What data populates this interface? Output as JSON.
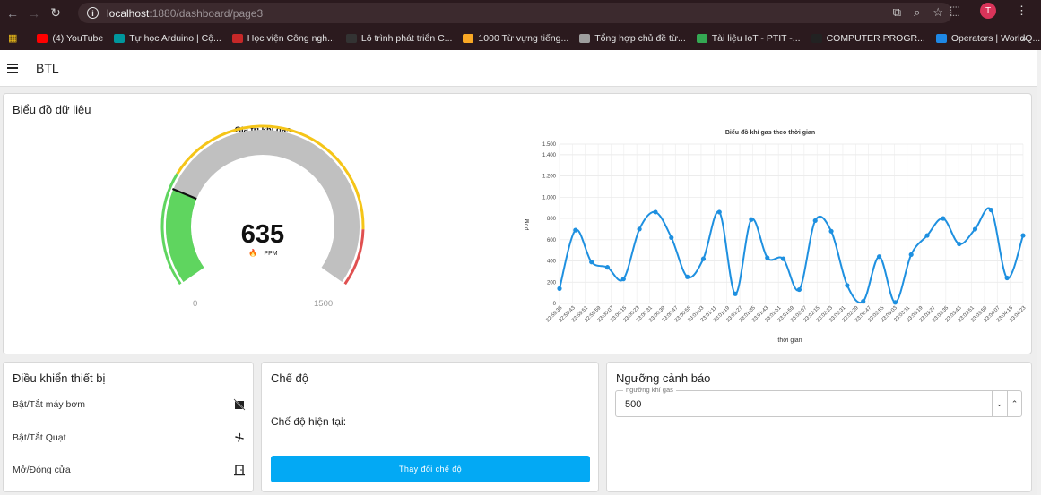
{
  "browser": {
    "url_host": "localhost",
    "url_path": ":1880/dashboard/page3",
    "avatar_letter": "T",
    "bookmarks": [
      {
        "label": "(4) YouTube",
        "color": "#ff0000"
      },
      {
        "label": "Tự học Arduino | Cộ...",
        "color": "#00979d"
      },
      {
        "label": "Học viện Công ngh...",
        "color": "#c62828"
      },
      {
        "label": "Lộ trình phát triển C...",
        "color": "#333333"
      },
      {
        "label": "1000 Từ vựng tiếng...",
        "color": "#f9a825"
      },
      {
        "label": "Tổng hợp chủ đề từ...",
        "color": "#9e9e9e"
      },
      {
        "label": "Tài liệu IoT - PTIT -...",
        "color": "#34a853"
      },
      {
        "label": "COMPUTER PROGR...",
        "color": "#222222"
      },
      {
        "label": "Operators | WorldQ...",
        "color": "#1e88e5"
      }
    ]
  },
  "app": {
    "title": "BTL"
  },
  "data_card": {
    "title": "Biểu đồ dữ liệu",
    "gauge": {
      "title": "Giá trị khí gas",
      "value": "635",
      "unit": "PPM",
      "min_label": "0",
      "max_label": "1500",
      "value_num": 635,
      "max": 1500,
      "green_end": 400,
      "yellow_end": 1300,
      "color_green": "#5fd55f",
      "color_yellow": "#f5c518",
      "color_red": "#e05050",
      "color_track": "#c0c0c0"
    }
  },
  "chart_data": {
    "type": "line",
    "title": "Biểu đồ khí gas theo thời gian",
    "xlabel": "thời gian",
    "ylabel": "PPM",
    "ylim": [
      0,
      1500
    ],
    "y_ticks": [
      "0",
      "200",
      "400",
      "600",
      "800",
      "1.000",
      "1.200",
      "1.400",
      "1.500"
    ],
    "y_tick_values": [
      0,
      200,
      400,
      600,
      800,
      1000,
      1200,
      1400,
      1500
    ],
    "grid": true,
    "line_color": "#1e90e0",
    "categories": [
      "22:59:35",
      "22:59:43",
      "22:59:51",
      "22:59:59",
      "23:00:07",
      "23:00:15",
      "23:00:23",
      "23:00:31",
      "23:00:39",
      "23:00:47",
      "23:00:55",
      "23:01:03",
      "23:01:11",
      "23:01:19",
      "23:01:27",
      "23:01:35",
      "23:01:43",
      "23:01:51",
      "23:01:59",
      "23:02:07",
      "23:02:15",
      "23:02:23",
      "23:02:31",
      "23:02:39",
      "23:02:47",
      "23:02:55",
      "23:03:03",
      "23:03:11",
      "23:03:19",
      "23:03:27",
      "23:03:35",
      "23:03:43",
      "23:03:51",
      "23:03:59",
      "23:04:07",
      "23:04:15",
      "23:04:23"
    ],
    "values": [
      140,
      690,
      390,
      340,
      230,
      700,
      860,
      620,
      250,
      420,
      860,
      90,
      790,
      430,
      420,
      130,
      780,
      680,
      170,
      20,
      440,
      10,
      460,
      640,
      800,
      560,
      700,
      880,
      240,
      640
    ]
  },
  "device_card": {
    "title": "Điều khiển thiết bị",
    "items": [
      {
        "label": "Bật/Tắt máy bơm",
        "icon": "pump-off-icon"
      },
      {
        "label": "Bật/Tắt Quạt",
        "icon": "fan-icon"
      },
      {
        "label": "Mở/Đóng cửa",
        "icon": "door-icon"
      }
    ]
  },
  "mode_card": {
    "title": "Chế độ",
    "current_label": "Chế độ hiện tại:",
    "button_label": "Thay đổi chế độ"
  },
  "threshold_card": {
    "title": "Ngưỡng cảnh báo",
    "field_label": "ngưỡng khí gas",
    "value": "500"
  }
}
